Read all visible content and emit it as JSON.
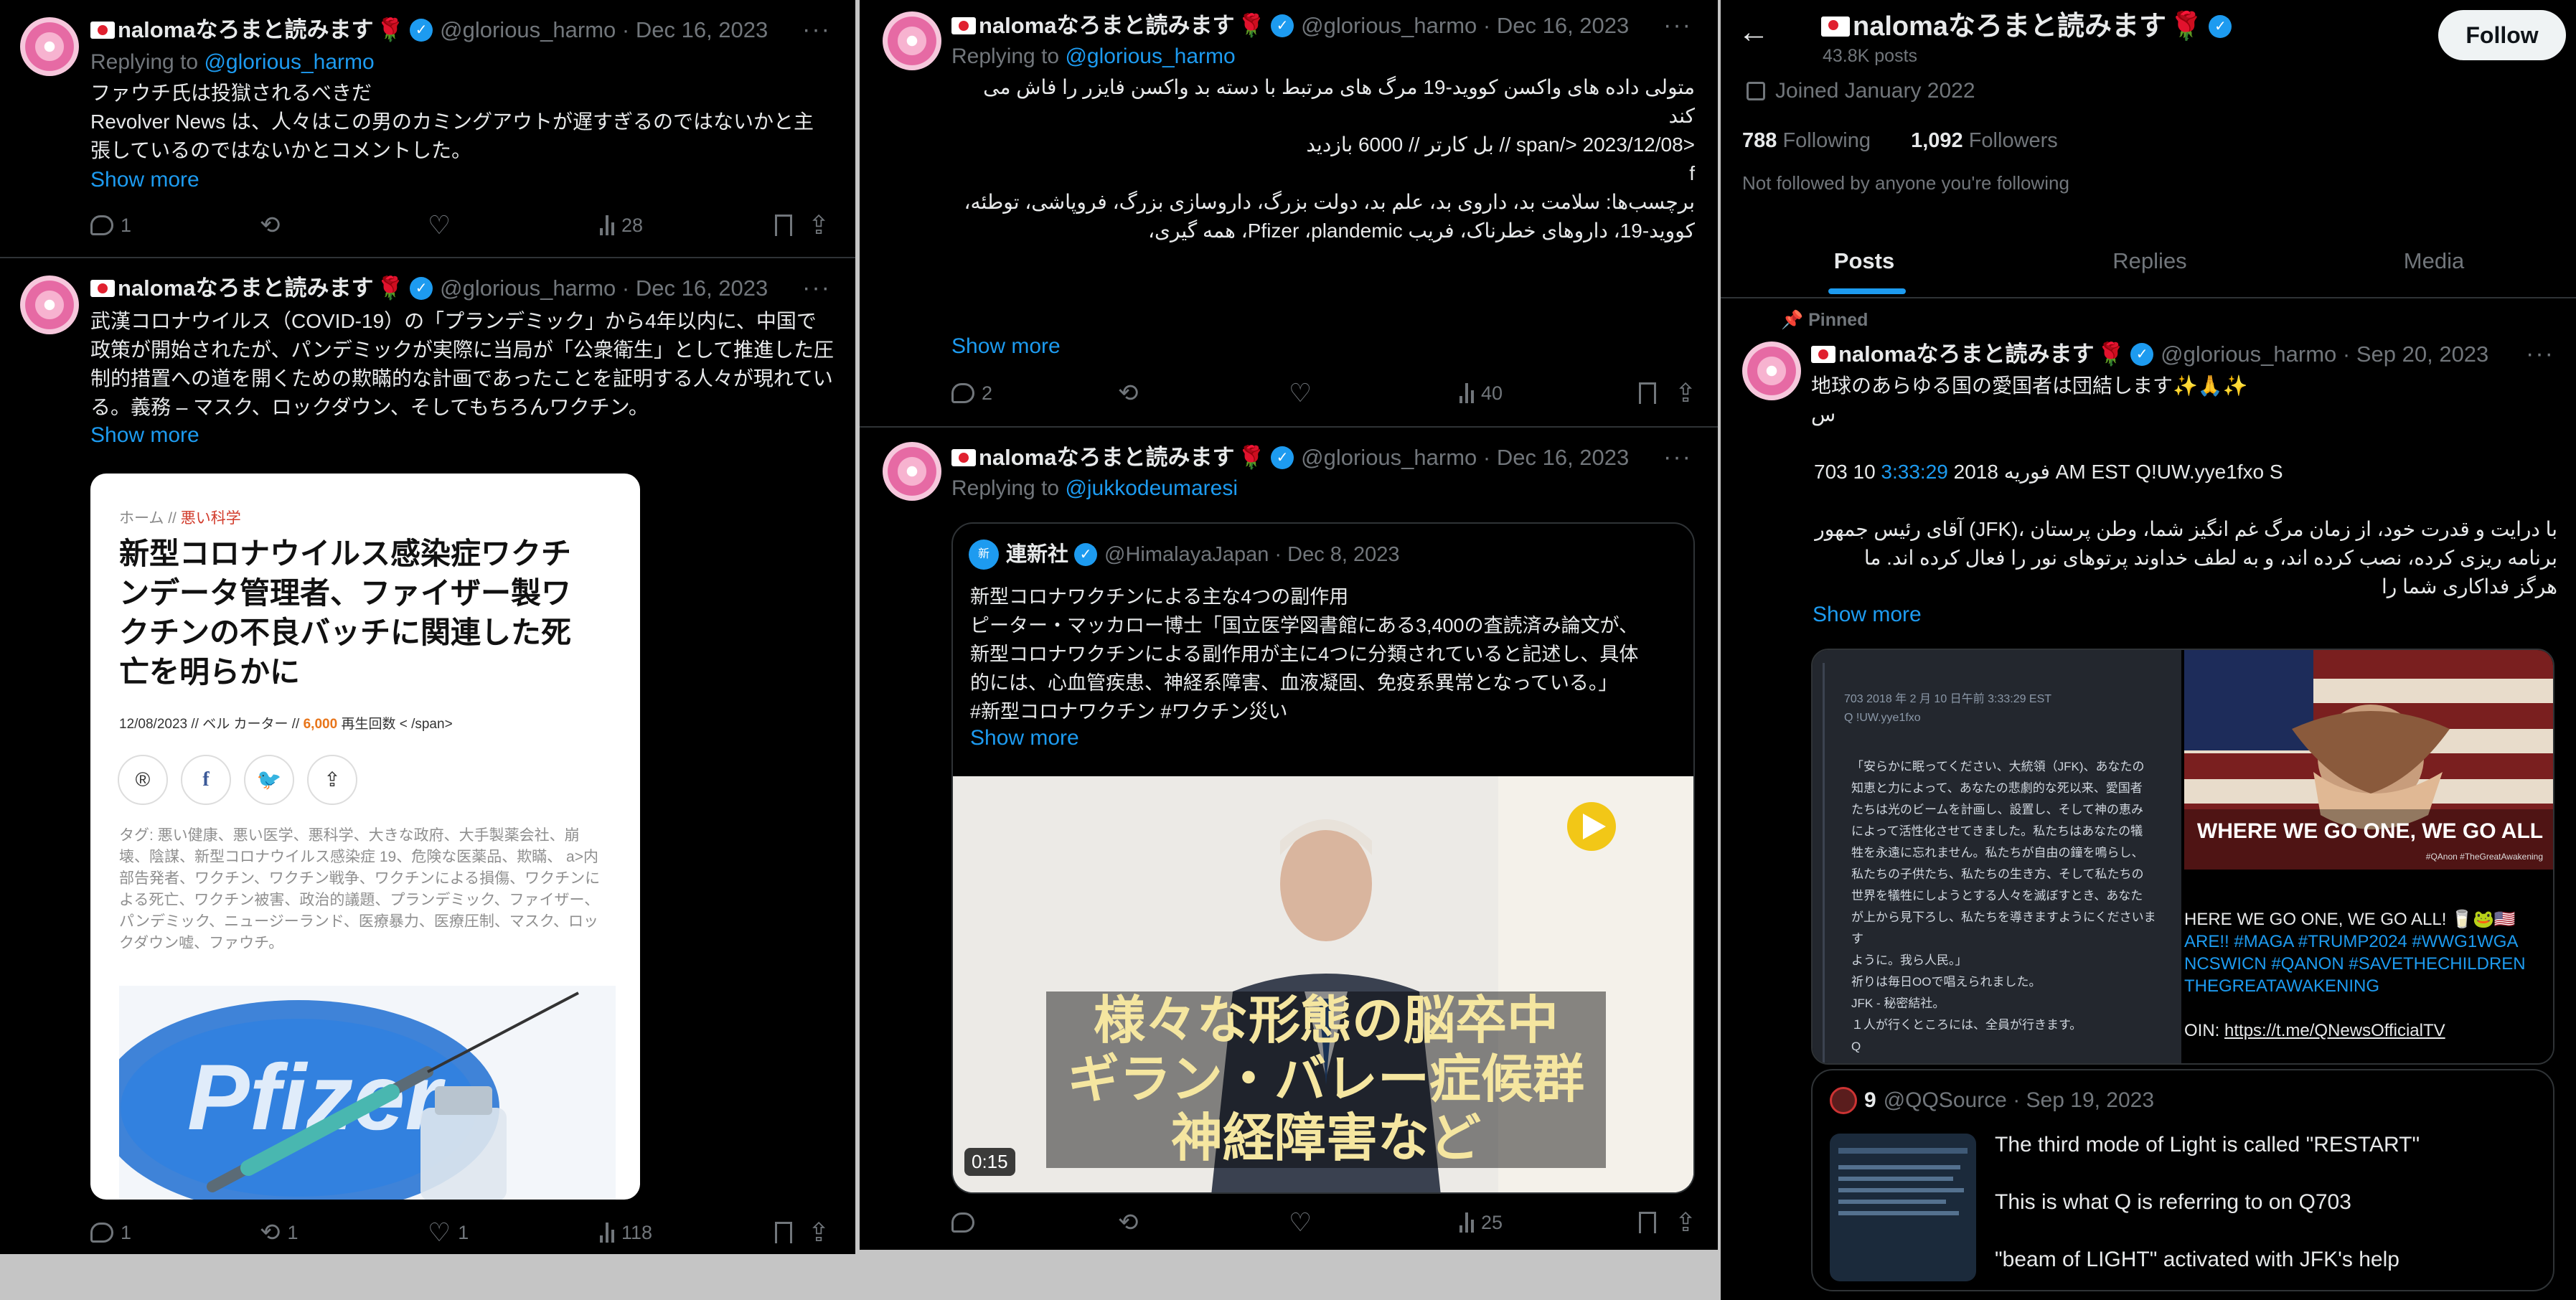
{
  "account": {
    "name": "nalomaなろまと読みます",
    "handle": "@glorious_harmo"
  },
  "actions_icons": [
    "reply-icon",
    "repost-icon",
    "like-icon",
    "views-icon",
    "bookmark-icon",
    "share-icon"
  ],
  "panel1": {
    "tweet1": {
      "date": "Dec 16, 2023",
      "replying_label": "Replying to",
      "replying_to": "@glorious_harmo",
      "lines": [
        "ファウチ氏は投獄されるべきだ",
        "Revolver News は、人々はこの男のカミングアウトが遅すぎるのではないかと主",
        "張しているのではないかとコメントした。"
      ],
      "show_more": "Show more",
      "replies": "1",
      "reposts": "",
      "likes": "",
      "views": "28"
    },
    "tweet2": {
      "date": "Dec 16, 2023",
      "lines": [
        "武漢コロナウイルス（COVID-19）の「プランデミック」から4年以内に、中国で",
        "政策が開始されたが、パンデミックが実際に当局が「公衆衛生」として推進した圧",
        "制的措置への道を開くための欺瞞的な計画であったことを証明する人々が現れてい",
        "る。義務 – マスク、ロックダウン、そしてもちろんワクチン。"
      ],
      "show_more": "Show more",
      "card": {
        "crumb_home": "ホーム //",
        "crumb_section": "悪い科学",
        "title_lines": [
          "新型コロナウイルス感染症ワクチ",
          "ンデータ管理者、ファイザー製ワ",
          "クチンの不良バッチに関連した死",
          "亡を明らかに"
        ],
        "meta_prefix": "12/08/2023 // ベル カーター //",
        "meta_views": "6,000",
        "meta_suffix": "再生回数 < /span>",
        "share_buttons": [
          "reddit-icon",
          "facebook-icon",
          "twitter-icon",
          "share-icon"
        ],
        "tags_lines": [
          "タグ: 悪い健康、悪い医学、悪科学、大きな政府、大手製薬会社、崩",
          "壊、陰謀、新型コロナウイルス感染症 19、危険な医薬品、欺瞞、 a>内",
          "部告発者、ワクチン、ワクチン戦争、ワクチンによる損傷、ワクチンに",
          "よる死亡、ワクチン被害、政治的議題、プランデミック、ファイザー、",
          "パンデミック、ニュージーランド、医療暴力、医療圧制、マスク、ロッ",
          "クダウン嘘、ファウチ。"
        ],
        "image_text": "Pfizer"
      },
      "replies": "1",
      "reposts": "1",
      "likes": "1",
      "views": "118"
    }
  },
  "panel2": {
    "tweet1": {
      "date": "Dec 16, 2023",
      "replying_label": "Replying to",
      "replying_to": "@glorious_harmo",
      "lines": [
        "متولی داده های واکسن کووید-19 مرگ های مرتبط با دسته بد واکسن فایزر را فاش می",
        "کند",
        "",
        "<span/> 2023/12/08 // بل کارتر // 6000 بازدید",
        "",
        "f",
        "",
        "برچسب‌ها: سلامت بد، داروی بد، علم بد، دولت بزرگ، داروسازی بزرگ، فروپاشی، توطئه،",
        "کووید-19، داروهای خطرناک، فریب Pfizer ،plandemic، همه گیری،"
      ],
      "show_more": "Show more",
      "replies": "2",
      "reposts": "",
      "likes": "",
      "views": "40"
    },
    "tweet2": {
      "date": "Dec 16, 2023",
      "replying_label": "Replying to",
      "replying_to": "@jukkodeumaresi",
      "quote": {
        "name": "連新社",
        "handle": "@HimalayaJapan",
        "date": "Dec 8, 2023",
        "lines": [
          "新型コロナワクチンによる主な4つの副作用",
          "ピーター・マッカロー博士「国立医学図書館にある3,400の査読済み論文が、",
          "新型コロナワクチンによる副作用が主に4つに分類されていると記述し、具体",
          "的には、心血管疾患、神経系障害、血液凝固、免疫系異常となっている。」",
          "#新型コロナワクチン #ワクチン災い"
        ],
        "show_more": "Show more",
        "video_subtitle": [
          "様々な形態の脳卒中",
          "ギラン・バレー症候群",
          "神経障害など"
        ],
        "video_duration": "0:15"
      },
      "replies": "",
      "reposts": "",
      "likes": "",
      "views": "25"
    }
  },
  "panel3": {
    "header": {
      "name": "nalomaなろまと読みます",
      "posts": "43.8K posts",
      "follow_label": "Follow"
    },
    "joined": "Joined January 2022",
    "following_count": "788",
    "following_label": "Following",
    "followers_count": "1,092",
    "followers_label": "Followers",
    "not_followed": "Not followed by anyone you're following",
    "tabs": [
      "Posts",
      "Replies",
      "Media"
    ],
    "pinned_label": "Pinned",
    "pinned": {
      "date": "Sep 20, 2023",
      "line1": "地球のあらゆる国の愛国者は団結します✨🙏✨",
      "line2": "س",
      "line3_prefix": "703 10",
      "line3_time": "3:33:29",
      "line3_suffix": "2018 فوریه AM EST Q!UW.yye1fxo S",
      "rtl_lines": [
        "با درایت و قدرت خود، از زمان مرگ غم انگیز شما، وطن پرستان ،(JFK) آقای رئیس جمهور",
        "برنامه ریزی کرده، نصب کرده اند، و به لطف خداوند پرتوهای نور را فعال کرده اند. ما",
        "هرگز فداکاری شما را"
      ],
      "show_more": "Show more",
      "media_left": {
        "header": "703  2018 年 2 月 10 日午前 3:33:29 EST",
        "qline": "Q  !UW.yye1fxo",
        "lines": [
          "「安らかに眠ってください、大統領（JFK)、あなたの",
          "知恵と力によって、あなたの悲劇的な死以来、愛国者",
          "たちは光のビームを計画し、設置し、そして神の恵み",
          "によって活性化させてきました。私たちはあなたの犠",
          "牲を永遠に忘れません。私たちが自由の鐘を鳴らし、",
          "私たちの子供たち、私たちの生き方、そして私たちの",
          "世界を犠牲にしようとする人々を滅ぼすとき、あなた",
          "が上から見下ろし、私たちを導きますようにくださいます",
          "ように。我ら人民。」",
          "祈りは毎日OOで唱えられました。",
          "JFK - 秘密結社。",
          "１人が行くところには、全員が行きます。",
          "Q"
        ]
      },
      "media_right": {
        "banner": "WHERE WE GO ONE, WE GO ALL",
        "tag": "#QAnon #TheGreatAwakening",
        "lines": [
          "HERE WE GO ONE, WE GO ALL! 🥛🐸🇺🇸",
          "ARE!! #MAGA #TRUMP2024 #WWG1WGA",
          "NCSWICN #QANON #SAVETHECHILDREN",
          "THEGREATAWAKENING"
        ],
        "join_label": "OIN:",
        "join_link": "https://t.me/QNewsOfficialTV"
      }
    },
    "quote": {
      "name": "9",
      "handle": "@QQSource",
      "date": "Sep 19, 2023",
      "lines": [
        "The third mode of Light is called \"RESTART\"",
        "This is what Q is referring to on Q703",
        "\"beam of LIGHT\" activated with JFK's help"
      ]
    }
  },
  "colors": {
    "background": "#000000",
    "text": "#e7e9ea",
    "muted": "#71767b",
    "link": "#1d9bf0",
    "divider": "#2f3336"
  }
}
